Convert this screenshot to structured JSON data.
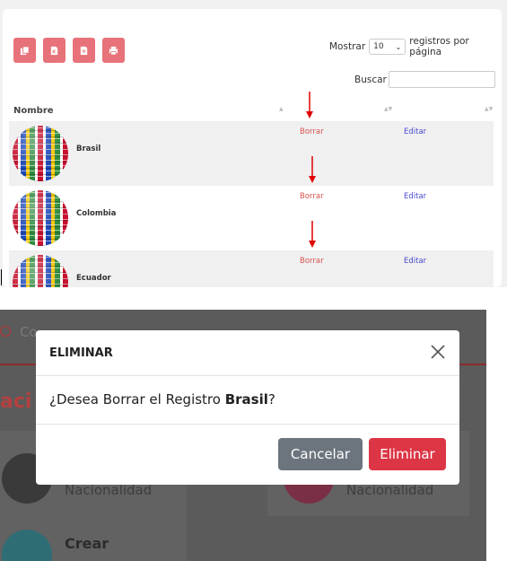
{
  "toolbar": {
    "icons": [
      "copy-icon",
      "excel-icon",
      "csv-icon",
      "print-icon"
    ]
  },
  "length": {
    "prefix": "Mostrar",
    "value": "10",
    "suffix": "registros por página"
  },
  "search": {
    "label": "Buscar",
    "value": ""
  },
  "table": {
    "column_name": "Nombre",
    "rows": [
      {
        "country": "Brasil",
        "delete": "Borrar",
        "edit": "Editar"
      },
      {
        "country": "Colombia",
        "delete": "Borrar",
        "edit": "Editar"
      },
      {
        "country": "Ecuador",
        "delete": "Borrar",
        "edit": "Editar"
      }
    ]
  },
  "background": {
    "window_title": "Co",
    "heading": "aci",
    "card_left_label": "Nacionalidad",
    "card_right_label": "Nacionalidad",
    "create_label": "Crear"
  },
  "modal": {
    "title": "ELIMINAR",
    "question_prefix": "¿Desea Borrar el Registro ",
    "record_name": "Brasil",
    "question_suffix": "?",
    "cancel_label": "Cancelar",
    "delete_label": "Eliminar"
  },
  "colors": {
    "toolbar_button": "#e8727a",
    "delete_link": "#d9534f",
    "edit_link": "#4a4ad0",
    "cancel_button": "#6c757d",
    "delete_button": "#dc3545",
    "annotation_arrow": "#e00000"
  }
}
